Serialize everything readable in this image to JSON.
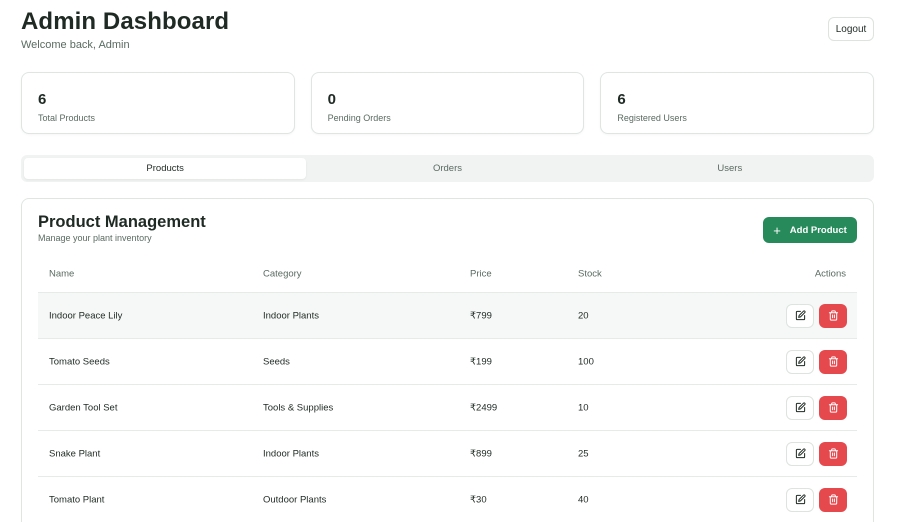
{
  "header": {
    "title": "Admin Dashboard",
    "subtitle": "Welcome back, Admin",
    "logout_label": "Logout"
  },
  "stats": [
    {
      "value": "6",
      "label": "Total Products"
    },
    {
      "value": "0",
      "label": "Pending Orders"
    },
    {
      "value": "6",
      "label": "Registered Users"
    }
  ],
  "tabs": [
    {
      "label": "Products",
      "active": true
    },
    {
      "label": "Orders",
      "active": false
    },
    {
      "label": "Users",
      "active": false
    }
  ],
  "panel": {
    "title": "Product Management",
    "subtitle": "Manage your plant inventory",
    "add_label": "Add Product",
    "columns": {
      "name": "Name",
      "category": "Category",
      "price": "Price",
      "stock": "Stock",
      "actions": "Actions"
    },
    "rows": [
      {
        "name": "Indoor Peace Lily",
        "category": "Indoor Plants",
        "price": "₹799",
        "stock": "20"
      },
      {
        "name": "Tomato Seeds",
        "category": "Seeds",
        "price": "₹199",
        "stock": "100"
      },
      {
        "name": "Garden Tool Set",
        "category": "Tools & Supplies",
        "price": "₹2499",
        "stock": "10"
      },
      {
        "name": "Snake Plant",
        "category": "Indoor Plants",
        "price": "₹899",
        "stock": "25"
      },
      {
        "name": "Tomato Plant",
        "category": "Outdoor Plants",
        "price": "₹30",
        "stock": "40"
      }
    ]
  },
  "colors": {
    "accent": "#278a5b",
    "danger": "#e5484d",
    "text": "#1f2a24",
    "muted": "#5a6b62"
  },
  "icons": {
    "add": "plus-icon",
    "edit": "edit-icon",
    "delete": "trash-icon"
  }
}
